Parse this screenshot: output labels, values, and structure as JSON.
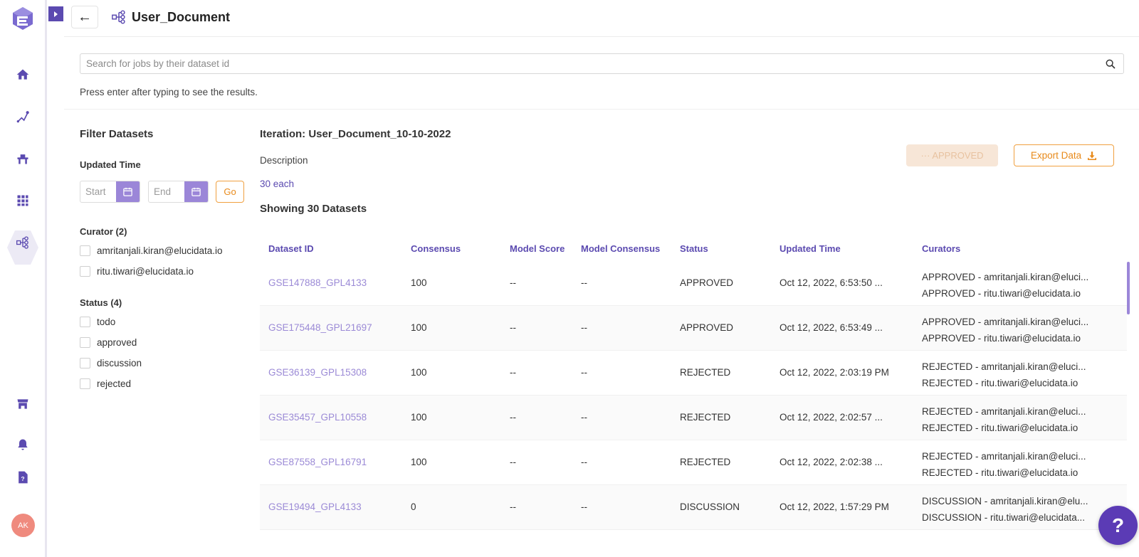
{
  "header": {
    "title": "User_Document"
  },
  "search": {
    "placeholder": "Search for jobs by their dataset id",
    "hint": "Press enter after typing to see the results."
  },
  "filters": {
    "title": "Filter Datasets",
    "updated_time_label": "Updated Time",
    "start_placeholder": "Start",
    "end_placeholder": "End",
    "go_label": "Go",
    "curator_label": "Curator (2)",
    "curators": [
      "amritanjali.kiran@elucidata.io",
      "ritu.tiwari@elucidata.io"
    ],
    "status_label": "Status (4)",
    "statuses": [
      "todo",
      "approved",
      "discussion",
      "rejected"
    ]
  },
  "main": {
    "iteration": "Iteration: User_Document_10-10-2022",
    "description_label": "Description",
    "description_value": "30 each",
    "showing": "Showing 30 Datasets",
    "approved_button": "··· APPROVED",
    "export_button": "Export Data"
  },
  "table": {
    "columns": [
      "Dataset ID",
      "Consensus",
      "Model Score",
      "Model Consensus",
      "Status",
      "Updated Time",
      "Curators"
    ],
    "rows": [
      {
        "id": "GSE147888_GPL4133",
        "consensus": "100",
        "model_score": "--",
        "model_consensus": "--",
        "status": "APPROVED",
        "updated": "Oct 12, 2022, 6:53:50 ...",
        "curator1": "APPROVED - amritanjali.kiran@eluci...",
        "curator2": "APPROVED - ritu.tiwari@elucidata.io"
      },
      {
        "id": "GSE175448_GPL21697",
        "consensus": "100",
        "model_score": "--",
        "model_consensus": "--",
        "status": "APPROVED",
        "updated": "Oct 12, 2022, 6:53:49 ...",
        "curator1": "APPROVED - amritanjali.kiran@eluci...",
        "curator2": "APPROVED - ritu.tiwari@elucidata.io"
      },
      {
        "id": "GSE36139_GPL15308",
        "consensus": "100",
        "model_score": "--",
        "model_consensus": "--",
        "status": "REJECTED",
        "updated": "Oct 12, 2022, 2:03:19 PM",
        "curator1": "REJECTED - amritanjali.kiran@eluci...",
        "curator2": "REJECTED - ritu.tiwari@elucidata.io"
      },
      {
        "id": "GSE35457_GPL10558",
        "consensus": "100",
        "model_score": "--",
        "model_consensus": "--",
        "status": "REJECTED",
        "updated": "Oct 12, 2022, 2:02:57 ...",
        "curator1": "REJECTED - amritanjali.kiran@eluci...",
        "curator2": "REJECTED - ritu.tiwari@elucidata.io"
      },
      {
        "id": "GSE87558_GPL16791",
        "consensus": "100",
        "model_score": "--",
        "model_consensus": "--",
        "status": "REJECTED",
        "updated": "Oct 12, 2022, 2:02:38 ...",
        "curator1": "REJECTED - amritanjali.kiran@eluci...",
        "curator2": "REJECTED - ritu.tiwari@elucidata.io"
      },
      {
        "id": "GSE19494_GPL4133",
        "consensus": "0",
        "model_score": "--",
        "model_consensus": "--",
        "status": "DISCUSSION",
        "updated": "Oct 12, 2022, 1:57:29 PM",
        "curator1": "DISCUSSION - amritanjali.kiran@elu...",
        "curator2": "DISCUSSION - ritu.tiwari@elucidata..."
      }
    ]
  },
  "user": {
    "initials": "AK"
  },
  "help": {
    "label": "?"
  },
  "icons": {
    "rail": [
      "home-icon",
      "pipeline-icon",
      "workbench-icon",
      "apps-grid-icon",
      "curation-icon",
      "store-icon",
      "bell-icon",
      "help-doc-icon"
    ]
  },
  "colors": {
    "accent": "#5b4ab0",
    "orange": "#e88a1a",
    "link": "#9b8ad6"
  }
}
